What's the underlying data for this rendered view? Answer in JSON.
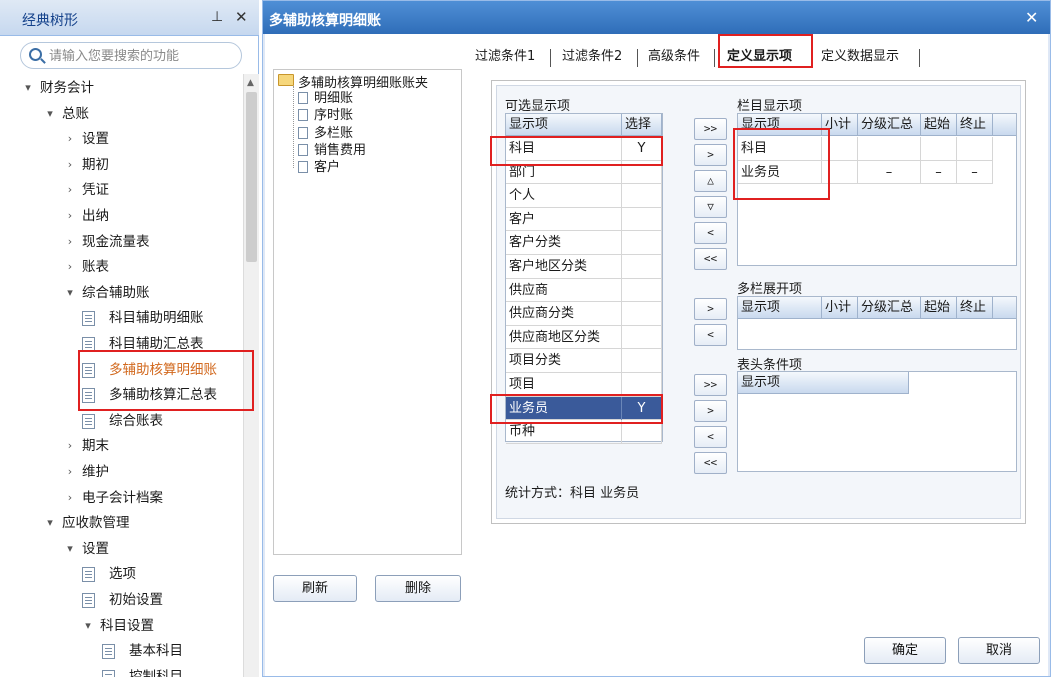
{
  "left_panel": {
    "title": "经典树形",
    "pin_glyph": "⊥",
    "close_glyph": "✕",
    "search_placeholder": "请输入您要搜索的功能",
    "tree": [
      {
        "label": "财务会计",
        "arrow": "▾",
        "level": 0
      },
      {
        "label": "总账",
        "arrow": "▾",
        "level": 1
      },
      {
        "label": "设置",
        "arrow": "›",
        "level": 2
      },
      {
        "label": "期初",
        "arrow": "›",
        "level": 2
      },
      {
        "label": "凭证",
        "arrow": "›",
        "level": 2
      },
      {
        "label": "出纳",
        "arrow": "›",
        "level": 2
      },
      {
        "label": "现金流量表",
        "arrow": "›",
        "level": 2
      },
      {
        "label": "账表",
        "arrow": "›",
        "level": 2
      },
      {
        "label": "综合辅助账",
        "arrow": "▾",
        "level": 2
      },
      {
        "label": "科目辅助明细账",
        "doc": true,
        "level": 3
      },
      {
        "label": "科目辅助汇总表",
        "doc": true,
        "level": 3
      },
      {
        "label": "多辅助核算明细账",
        "doc": true,
        "level": 3,
        "highlight": true
      },
      {
        "label": "多辅助核算汇总表",
        "doc": true,
        "level": 3
      },
      {
        "label": "综合账表",
        "doc": true,
        "level": 3
      },
      {
        "label": "期末",
        "arrow": "›",
        "level": 2
      },
      {
        "label": "维护",
        "arrow": "›",
        "level": 2
      },
      {
        "label": "电子会计档案",
        "arrow": "›",
        "level": 2
      },
      {
        "label": "应收款管理",
        "arrow": "▾",
        "level": 1
      },
      {
        "label": "设置",
        "arrow": "▾",
        "level": 2
      },
      {
        "label": "选项",
        "doc": true,
        "level": 3
      },
      {
        "label": "初始设置",
        "doc": true,
        "level": 3
      },
      {
        "label": "科目设置",
        "arrow": "▾",
        "level": 3
      },
      {
        "label": "基本科目",
        "doc": true,
        "level": 4
      },
      {
        "label": "控制科目",
        "doc": true,
        "level": 4
      }
    ]
  },
  "dialog": {
    "title": "多辅助核算明细账",
    "close_glyph": "✕",
    "account_tree": {
      "root": "多辅助核算明细账账夹",
      "items": [
        "明细账",
        "序时账",
        "多栏账",
        "销售费用",
        "客户"
      ]
    },
    "buttons": {
      "refresh": "刷新",
      "delete": "删除",
      "ok": "确定",
      "cancel": "取消"
    },
    "tabs": [
      "过滤条件1",
      "过滤条件2",
      "高级条件",
      "定义显示项",
      "定义数据显示"
    ],
    "active_tab": "定义显示项",
    "available": {
      "label": "可选显示项",
      "headers": [
        "显示项",
        "选择"
      ],
      "rows": [
        {
          "name": "科目",
          "select": "Y"
        },
        {
          "name": "部门",
          "select": ""
        },
        {
          "name": "个人",
          "select": ""
        },
        {
          "name": "客户",
          "select": ""
        },
        {
          "name": "客户分类",
          "select": ""
        },
        {
          "name": "客户地区分类",
          "select": ""
        },
        {
          "name": "供应商",
          "select": ""
        },
        {
          "name": "供应商分类",
          "select": ""
        },
        {
          "name": "供应商地区分类",
          "select": ""
        },
        {
          "name": "项目分类",
          "select": ""
        },
        {
          "name": "项目",
          "select": ""
        },
        {
          "name": "业务员",
          "select": "Y",
          "selected": true
        },
        {
          "name": "币种",
          "select": ""
        }
      ]
    },
    "move_buttons_1": [
      ">>",
      ">",
      "△",
      "▽",
      "<",
      "<<"
    ],
    "move_buttons_2": [
      ">",
      "<"
    ],
    "move_buttons_3": [
      ">>",
      ">",
      "<",
      "<<"
    ],
    "column_display": {
      "label": "栏目显示项",
      "headers": [
        "显示项",
        "小计",
        "分级汇总",
        "起始",
        "终止"
      ],
      "rows": [
        [
          "科目",
          "",
          "",
          "",
          ""
        ],
        [
          "业务员",
          "",
          "–",
          "–",
          "–"
        ]
      ]
    },
    "multi_column": {
      "label": "多栏展开项",
      "headers": [
        "显示项",
        "小计",
        "分级汇总",
        "起始",
        "终止"
      ]
    },
    "header_condition": {
      "label": "表头条件项",
      "headers": [
        "显示项"
      ]
    },
    "stat_method": "统计方式：科目 业务员"
  }
}
